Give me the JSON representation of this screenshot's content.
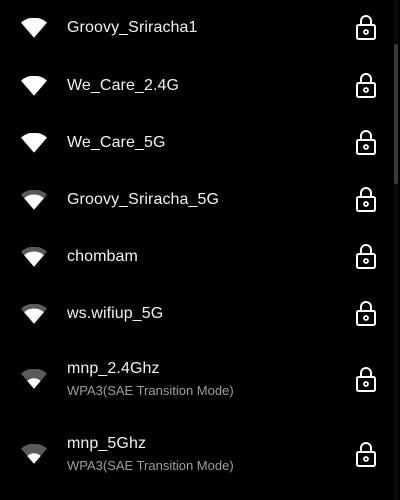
{
  "networks": [
    {
      "ssid": "Groovy_Sriracha1",
      "subtitle": "",
      "signal_icon": "wifi-full-icon",
      "secured": true
    },
    {
      "ssid": "We_Care_2.4G",
      "subtitle": "",
      "signal_icon": "wifi-full-icon",
      "secured": true
    },
    {
      "ssid": "We_Care_5G",
      "subtitle": "",
      "signal_icon": "wifi-full-icon",
      "secured": true
    },
    {
      "ssid": "Groovy_Sriracha_5G",
      "subtitle": "",
      "signal_icon": "wifi-strong-icon",
      "secured": true
    },
    {
      "ssid": "chombam",
      "subtitle": "",
      "signal_icon": "wifi-strong-icon",
      "secured": true
    },
    {
      "ssid": "ws.wifiup_5G",
      "subtitle": "",
      "signal_icon": "wifi-strong-icon",
      "secured": true
    },
    {
      "ssid": "mnp_2.4Ghz",
      "subtitle": "WPA3(SAE Transition Mode)",
      "signal_icon": "wifi-medium-icon",
      "secured": true
    },
    {
      "ssid": "mnp_5Ghz",
      "subtitle": "WPA3(SAE Transition Mode)",
      "signal_icon": "wifi-medium-icon",
      "secured": true
    }
  ],
  "colors": {
    "background": "#000000",
    "text_primary": "#f2f2f2",
    "text_secondary": "#9e9e9e",
    "icon_on": "#ffffff",
    "icon_off": "#5a5a5a"
  }
}
